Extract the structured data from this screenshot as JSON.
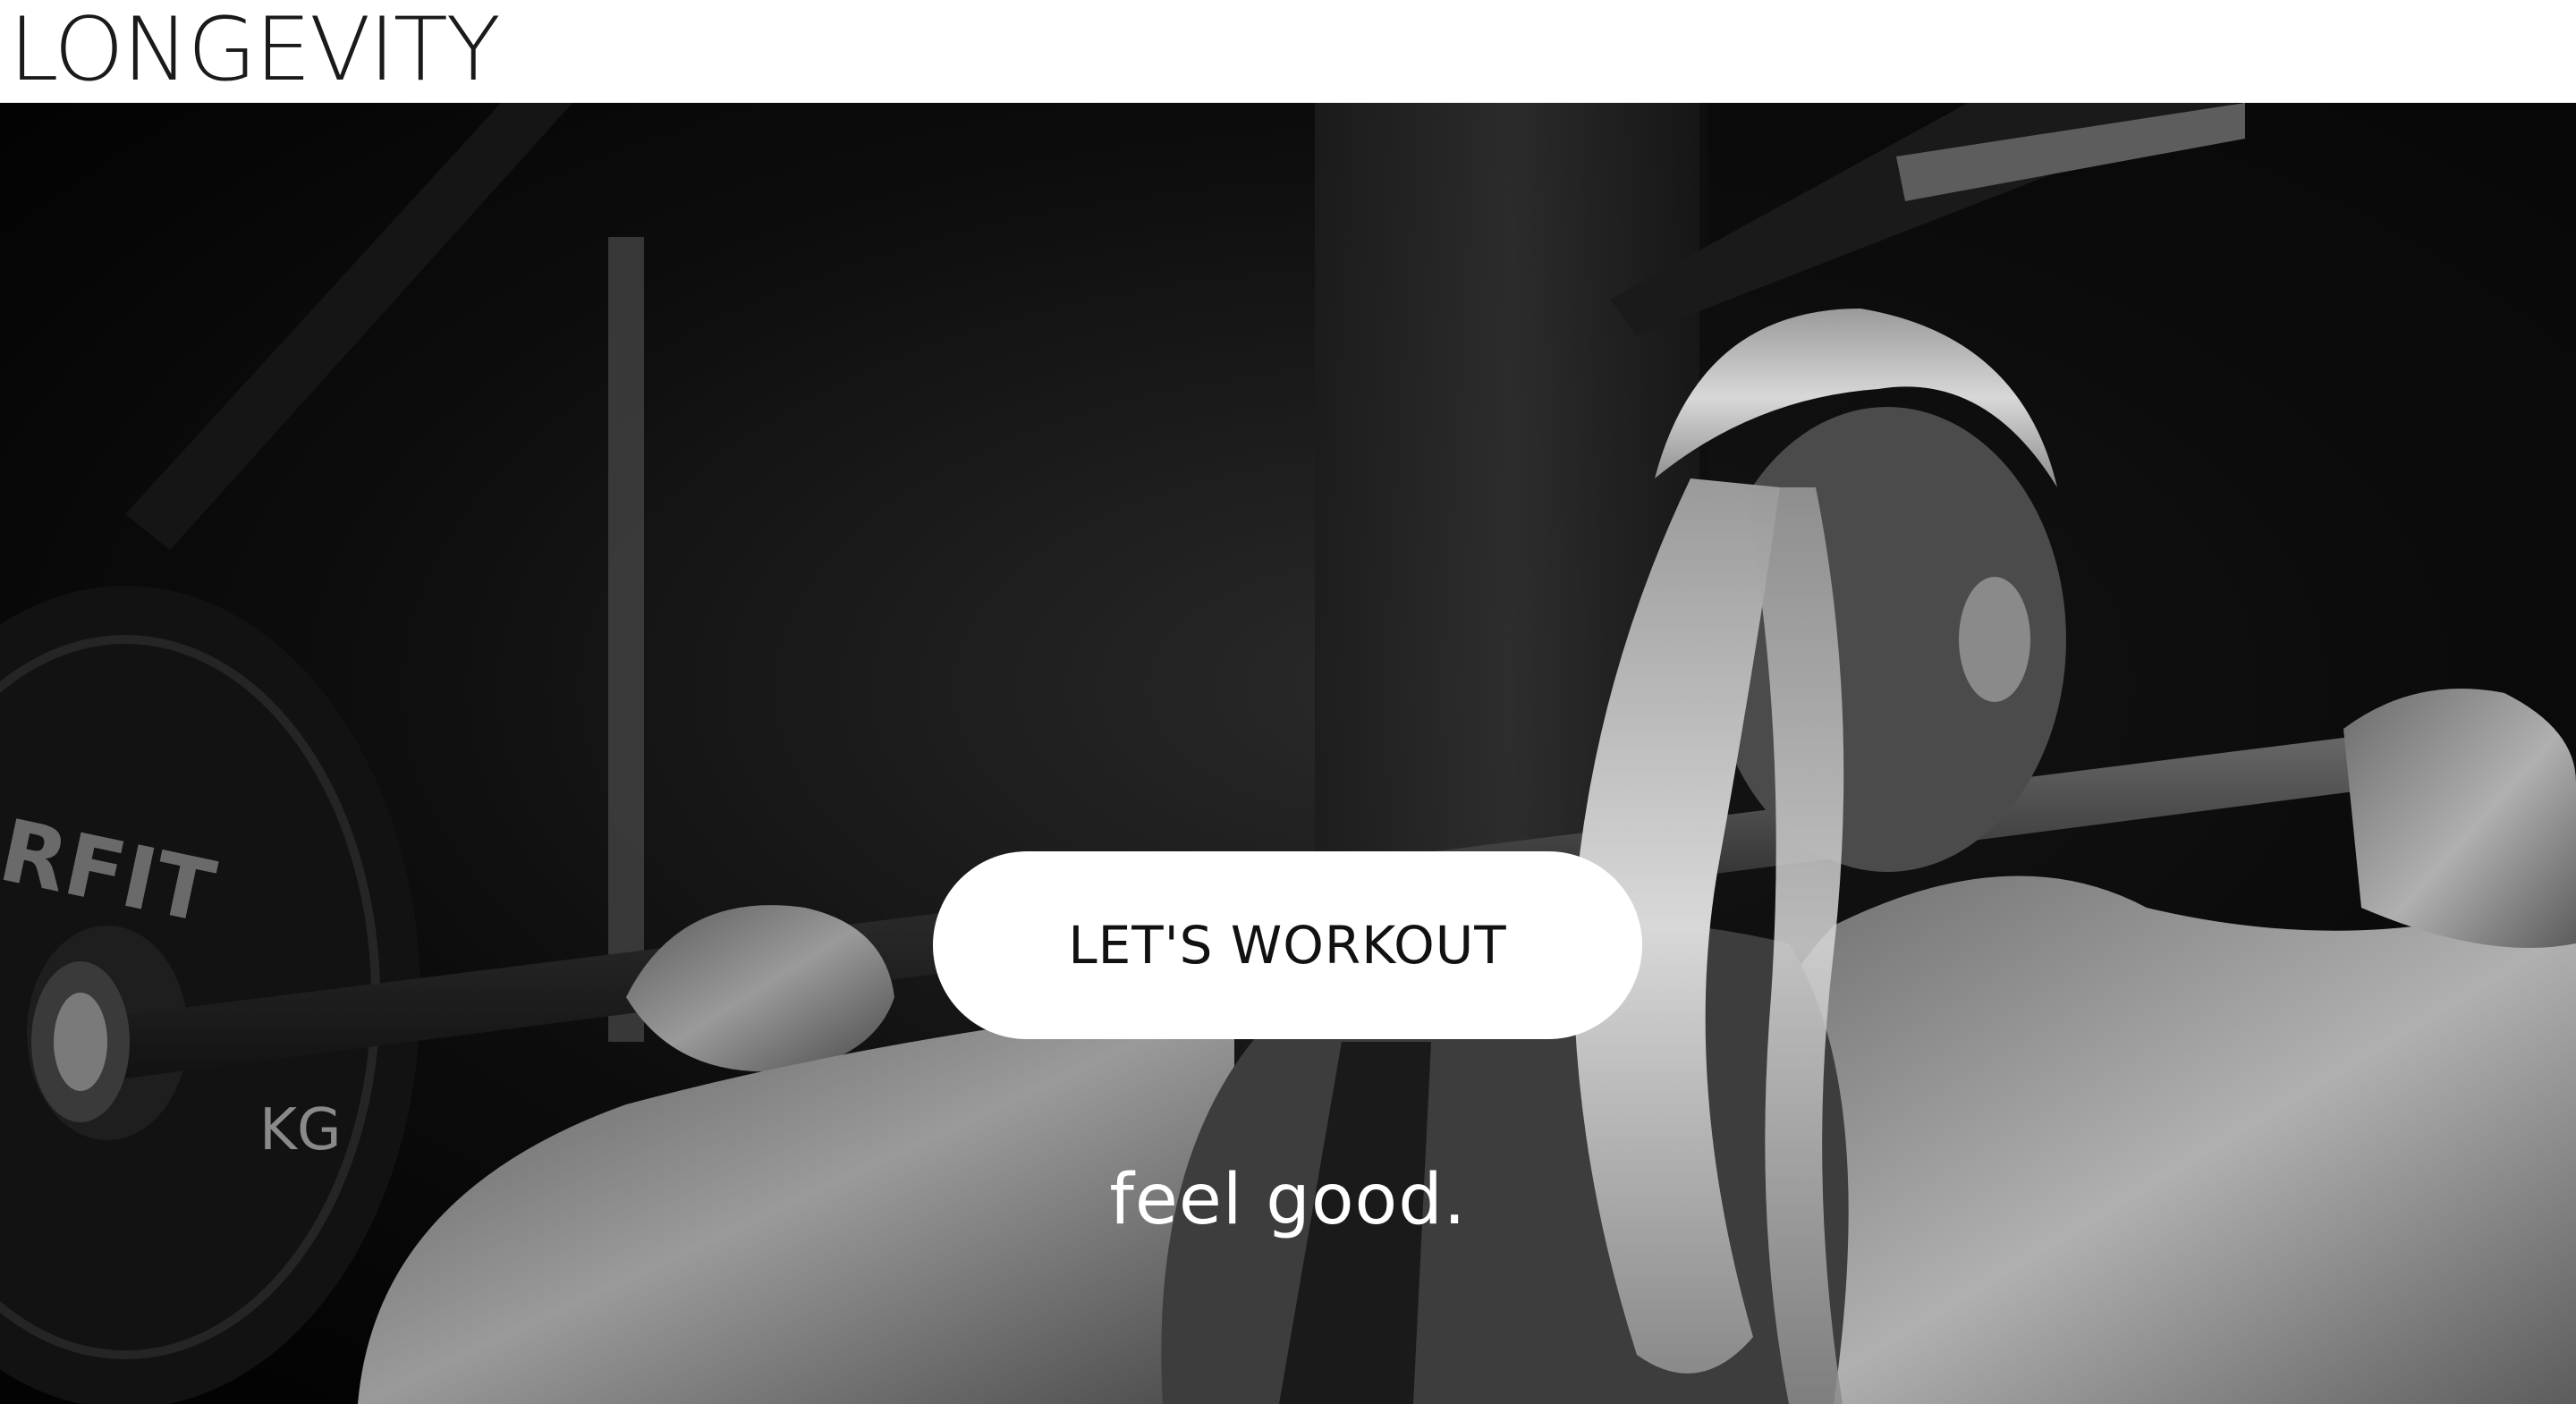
{
  "brand": {
    "logo_text": "LONGEVITY"
  },
  "hero": {
    "cta_label": "LET'S WORKOUT",
    "tagline": "feel good.",
    "image_description_icon": "weightlifter-photo",
    "plate_text_1": "RFIT",
    "plate_text_2": "KG"
  },
  "colors": {
    "header_bg": "#ffffff",
    "hero_bg": "#000000",
    "cta_bg": "#ffffff",
    "cta_text": "#111111",
    "tagline_text": "#ffffff"
  }
}
